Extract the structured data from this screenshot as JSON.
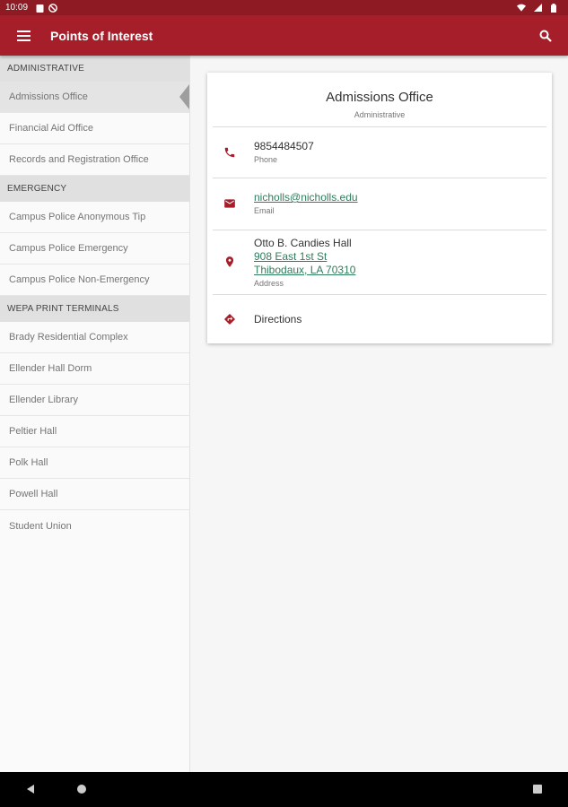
{
  "status_bar": {
    "time": "10:09",
    "left_icons": [
      "clipboard-icon",
      "no-entry-icon"
    ],
    "right_icons": [
      "wifi-icon",
      "signal-icon",
      "battery-icon"
    ]
  },
  "app_bar": {
    "title": "Points of Interest",
    "color": "#a61e2a",
    "menu_icon": "hamburger-menu-icon",
    "search_icon": "search-icon"
  },
  "sidebar": {
    "sections": [
      {
        "header": "ADMINISTRATIVE",
        "items": [
          "Admissions Office",
          "Financial Aid Office",
          "Records and Registration Office"
        ]
      },
      {
        "header": "EMERGENCY",
        "items": [
          "Campus Police Anonymous Tip",
          "Campus Police Emergency",
          "Campus Police Non-Emergency"
        ]
      },
      {
        "header": "WEPA PRINT TERMINALS",
        "items": [
          "Brady Residential Complex",
          "Ellender Hall Dorm",
          "Ellender Library",
          "Peltier Hall",
          "Polk Hall",
          "Powell Hall",
          "Student Union"
        ]
      }
    ],
    "selected": "Admissions Office"
  },
  "detail": {
    "title": "Admissions Office",
    "category": "Administrative",
    "phone": {
      "value": "9854484507",
      "label": "Phone",
      "icon": "phone-icon"
    },
    "email": {
      "value": "nicholls@nicholls.edu",
      "label": "Email",
      "icon": "email-icon"
    },
    "address": {
      "name": "Otto B. Candies Hall",
      "street": "908 East 1st St",
      "city": "Thibodaux, LA  70310",
      "label": "Address",
      "icon": "location-pin-icon"
    },
    "directions": {
      "label": "Directions",
      "icon": "directions-icon"
    },
    "accent_color": "#a61e2a",
    "link_color": "#2e7d5b"
  },
  "nav_bar": {
    "icons": [
      "back-icon",
      "home-icon",
      "recents-icon"
    ]
  }
}
